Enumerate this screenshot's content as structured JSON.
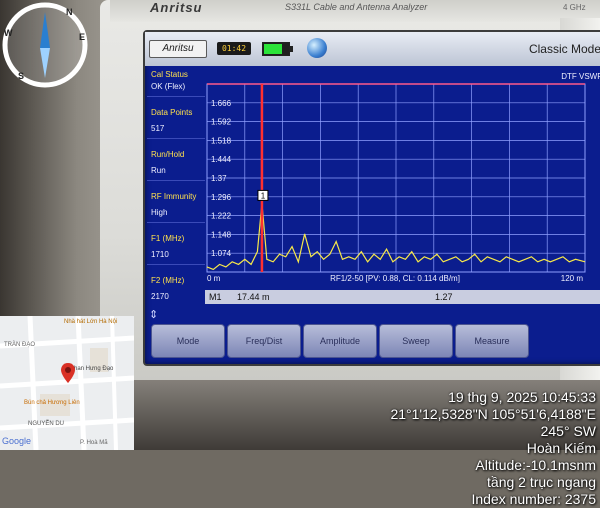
{
  "device": {
    "brand": "Anritsu",
    "model_text": "S331L Cable and Antenna Analyzer",
    "freq_label": "4 GHz"
  },
  "screen": {
    "logo": "Anritsu",
    "clock": "01:42",
    "battery_level": 0.75,
    "mode_title": "Classic Mode",
    "trace_name": "DTF VSWR",
    "sidebar": [
      {
        "label": "Cal Status",
        "value": "OK (Flex)"
      },
      {
        "label": "Data Points",
        "value": "517"
      },
      {
        "label": "Run/Hold",
        "value": "Run"
      },
      {
        "label": "RF Immunity",
        "value": "High"
      },
      {
        "label": "F1 (MHz)",
        "value": "1710"
      },
      {
        "label": "F2 (MHz)",
        "value": "2170"
      }
    ],
    "marker_readout": {
      "name": "M1",
      "position": "17.44 m",
      "value": "1.27"
    },
    "softkeys": [
      "Mode",
      "Freq/Dist",
      "Amplitude",
      "Sweep",
      "Measure"
    ]
  },
  "chart_data": {
    "type": "line",
    "title": "DTF VSWR",
    "xlabel": "",
    "ylabel": "",
    "x_start_label": "0 m",
    "x_end_label": "120 m",
    "x_range": [
      0,
      120
    ],
    "ylim": [
      1.0,
      1.74
    ],
    "y_ticks": [
      "1.666",
      "1.592",
      "1.518",
      "1.444",
      "1.37",
      "1.296",
      "1.222",
      "1.148",
      "1.074"
    ],
    "y_tick_values": [
      1.666,
      1.592,
      1.518,
      1.444,
      1.37,
      1.296,
      1.222,
      1.148,
      1.074
    ],
    "grid": true,
    "footer_info": "RF1/2-50 [PV: 0.88, CL: 0.114 dB/m]",
    "marker": {
      "label": "1",
      "x": 17.44,
      "y": 1.27
    },
    "limit_line": 1.74,
    "series": [
      {
        "x": [
          0,
          2,
          4,
          6,
          8,
          10,
          12,
          14,
          16,
          17.44,
          19,
          21,
          23,
          25,
          27,
          29,
          31,
          33,
          35,
          37,
          39,
          41,
          43,
          45,
          47,
          49,
          51,
          53,
          55,
          57,
          59,
          61,
          63,
          65,
          67,
          69,
          71,
          73,
          75,
          77,
          79,
          81,
          83,
          85,
          87,
          89,
          91,
          93,
          95,
          97,
          99,
          101,
          103,
          105,
          107,
          109,
          111,
          113,
          115,
          117,
          120
        ],
        "y": [
          1.02,
          1.01,
          1.03,
          1.02,
          1.04,
          1.03,
          1.05,
          1.03,
          1.08,
          1.27,
          1.05,
          1.04,
          1.07,
          1.06,
          1.1,
          1.04,
          1.15,
          1.06,
          1.08,
          1.05,
          1.07,
          1.12,
          1.05,
          1.06,
          1.05,
          1.08,
          1.04,
          1.07,
          1.05,
          1.09,
          1.04,
          1.06,
          1.05,
          1.08,
          1.04,
          1.06,
          1.05,
          1.07,
          1.04,
          1.05,
          1.06,
          1.04,
          1.05,
          1.07,
          1.04,
          1.06,
          1.05,
          1.04,
          1.06,
          1.05,
          1.04,
          1.05,
          1.06,
          1.04,
          1.05,
          1.04,
          1.05,
          1.06,
          1.04,
          1.05,
          1.04
        ]
      }
    ]
  },
  "compass": {
    "north": "N",
    "east": "E",
    "south": "S",
    "west": "W"
  },
  "map": {
    "labels": [
      "Nhà hát Lớn Hà Nội",
      "TRÀN ĐẠO",
      "Phan Hưng Đạo",
      "Bún chả Hương Liên",
      "NGUYỄN DU",
      "Google",
      "P. Hoà Mã"
    ],
    "pin_color": "#d93025"
  },
  "gps": {
    "datetime": "19 thg 9, 2025 10:45:33",
    "coords": "21°1'12,5328\"N 105°51'6,4188\"E",
    "heading": "245° SW",
    "district": "Hoàn Kiếm",
    "altitude": "Altitude:-10.1msnm",
    "note": "tầng 2 trục ngang",
    "index": "Index number: 2375"
  },
  "colors": {
    "screen_bg": "#0b1d8e",
    "grid": "#8fa0ff",
    "trace": "#f7e84a",
    "marker_line": "#ff3030",
    "limit_line": "#ff5a8a"
  }
}
